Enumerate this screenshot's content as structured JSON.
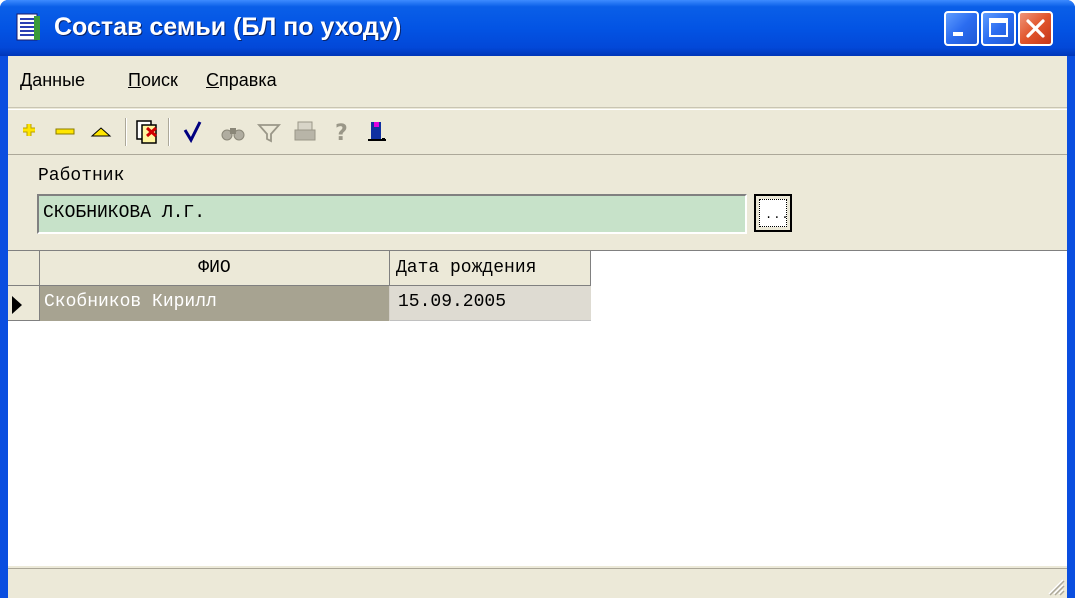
{
  "window": {
    "title": "Состав семьи (БЛ по уходу)"
  },
  "menu": {
    "items": [
      "Данные",
      "Поиск",
      "Справка"
    ]
  },
  "toolbar": {
    "icons": [
      "add-icon",
      "delete-icon",
      "edit-icon",
      "copy-record-icon",
      "confirm-icon",
      "find-icon",
      "filter-icon",
      "print-icon",
      "help-icon",
      "exit-icon"
    ]
  },
  "form": {
    "worker_label": "Работник",
    "worker_value": "СКОБНИКОВА Л.Г."
  },
  "grid": {
    "columns": [
      "ФИО",
      "Дата рождения"
    ],
    "rows": [
      {
        "fio": "Скобников Кирилл",
        "birth_date": "15.09.2005"
      }
    ]
  },
  "colors": {
    "titlebar": "#0354e4",
    "client_bg": "#ece9d8",
    "worker_field_bg": "#c7e2c9",
    "selected_cell_bg": "#a7a391"
  }
}
